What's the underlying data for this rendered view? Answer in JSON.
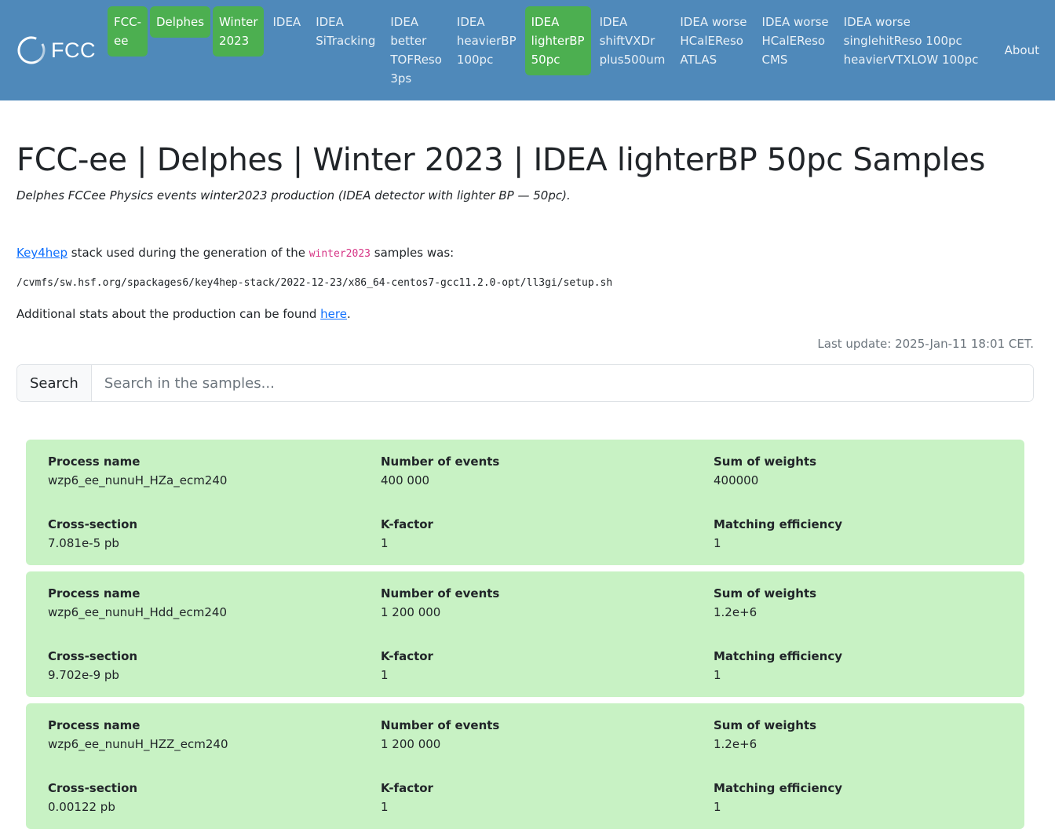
{
  "navbar": {
    "brand": "FCC",
    "items": [
      {
        "lines": [
          "FCC-",
          "ee"
        ],
        "active": true
      },
      {
        "lines": [
          "Delphes"
        ],
        "active": true
      },
      {
        "lines": [
          "Winter",
          "2023"
        ],
        "active": true
      },
      {
        "lines": [
          "IDEA"
        ],
        "active": false
      },
      {
        "lines": [
          "IDEA",
          "SiTracking"
        ],
        "active": false
      },
      {
        "lines": [
          "IDEA",
          "better",
          "TOFReso",
          "3ps"
        ],
        "active": false
      },
      {
        "lines": [
          "IDEA",
          "heavierBP",
          "100pc"
        ],
        "active": false
      },
      {
        "lines": [
          "IDEA",
          "lighterBP",
          "50pc"
        ],
        "active": true
      },
      {
        "lines": [
          "IDEA",
          "shiftVXDr",
          "plus500um"
        ],
        "active": false
      },
      {
        "lines": [
          "IDEA worse",
          "HCalEReso",
          "ATLAS"
        ],
        "active": false
      },
      {
        "lines": [
          "IDEA worse",
          "HCalEReso",
          "CMS"
        ],
        "active": false
      },
      {
        "lines": [
          "IDEA worse",
          "singlehitReso 100pc",
          "heavierVTXLOW 100pc"
        ],
        "active": false
      }
    ],
    "about": "About",
    "colors": {
      "background": "#4f89ba",
      "active": "#4caf50"
    }
  },
  "page": {
    "title": "FCC-ee | Delphes | Winter 2023 | IDEA lighterBP 50pc Samples",
    "subtitle": "Delphes FCCee Physics events winter2023 production (IDEA detector with lighter BP — 50pc).",
    "stack_link": "Key4hep",
    "stack_text_1": " stack used during the generation of the ",
    "stack_code": "winter2023",
    "stack_text_2": " samples was:",
    "stack_path": "/cvmfs/sw.hsf.org/spackages6/key4hep-stack/2022-12-23/x86_64-centos7-gcc11.2.0-opt/ll3gi/setup.sh",
    "stats_text": "Additional stats about the production can be found ",
    "stats_link": "here",
    "stats_end": ".",
    "last_update": "Last update: 2025-Jan-11 18:01 CET."
  },
  "search": {
    "label": "Search",
    "placeholder": "Search in the samples...",
    "value": ""
  },
  "labels": {
    "process_name": "Process name",
    "n_events": "Number of events",
    "sum_weights": "Sum of weights",
    "cross_section": "Cross-section",
    "k_factor": "K-factor",
    "matching_eff": "Matching efficiency"
  },
  "samples": [
    {
      "process_name": "wzp6_ee_nunuH_HZa_ecm240",
      "n_events": "400 000",
      "sum_weights": "400000",
      "cross_section": "7.081e-5 pb",
      "k_factor": "1",
      "matching_eff": "1"
    },
    {
      "process_name": "wzp6_ee_nunuH_Hdd_ecm240",
      "n_events": "1 200 000",
      "sum_weights": "1.2e+6",
      "cross_section": "9.702e-9 pb",
      "k_factor": "1",
      "matching_eff": "1"
    },
    {
      "process_name": "wzp6_ee_nunuH_HZZ_ecm240",
      "n_events": "1 200 000",
      "sum_weights": "1.2e+6",
      "cross_section": "0.00122 pb",
      "k_factor": "1",
      "matching_eff": "1"
    }
  ],
  "card_color": "#c8f2c4"
}
